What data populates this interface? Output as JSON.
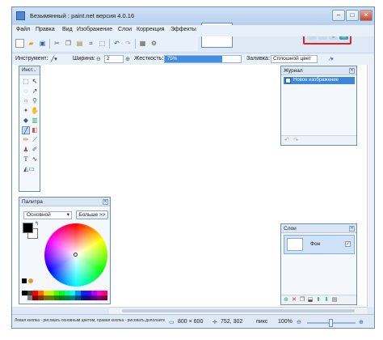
{
  "title": "Безымянный : paint.net версия 4.0.16",
  "window_controls": {
    "minimize": "–",
    "maximize": "□",
    "close": "✕"
  },
  "menu": [
    "Файл",
    "Правка",
    "Вид",
    "Изображение",
    "Слои",
    "Коррекция",
    "Эффекты"
  ],
  "toolbar": {
    "tool_label": "Инструмент:",
    "width_label": "Ширина:",
    "width_value": "2",
    "hardness_label": "Жесткость:",
    "hardness_value": "75%",
    "hardness_fraction": 0.75,
    "fill_label": "Заливка:",
    "fill_value": "Сплошной цвет"
  },
  "tools_panel": {
    "title": "Инст..."
  },
  "history_panel": {
    "title": "Журнал",
    "items": [
      "Новое изображение"
    ]
  },
  "layers_panel": {
    "title": "Слои",
    "layers": [
      {
        "name": "Фон",
        "visible": "✓"
      }
    ]
  },
  "palette_panel": {
    "title": "Палитра",
    "mode": "Основной",
    "more_button": "Больше >>"
  },
  "status": {
    "hint": "Левая кнопка - рисовать основным цветом, правая кнопка - рисовать дополнительным цветом.",
    "image_size": "800 × 600",
    "cursor_pos": "752, 302",
    "units": "пикс",
    "zoom": "100%"
  },
  "colors": {
    "accent": "#3d87d9",
    "highlight_box": "#e0242a",
    "hardness_fill": "#3f8ee6"
  }
}
